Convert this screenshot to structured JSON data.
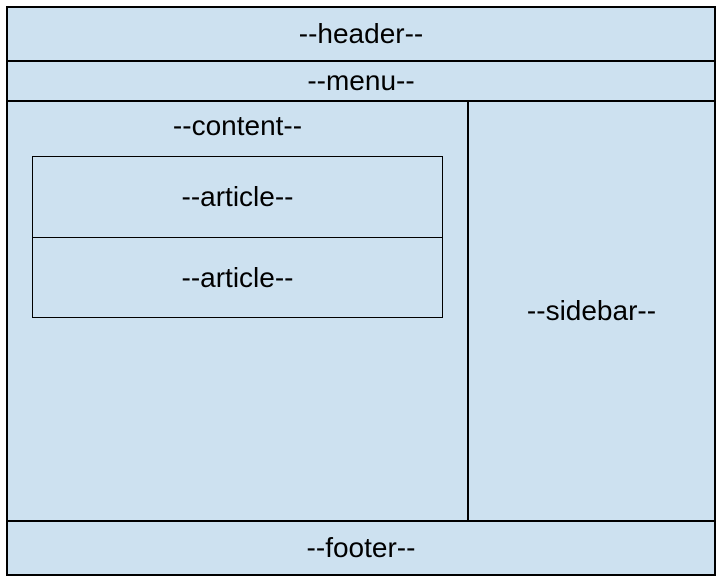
{
  "header": {
    "label": "--header--"
  },
  "menu": {
    "label": "--menu--"
  },
  "content": {
    "label": "--content--",
    "articles": [
      {
        "label": "--article--"
      },
      {
        "label": "--article--"
      }
    ]
  },
  "sidebar": {
    "label": "--sidebar--"
  },
  "footer": {
    "label": "--footer--"
  }
}
